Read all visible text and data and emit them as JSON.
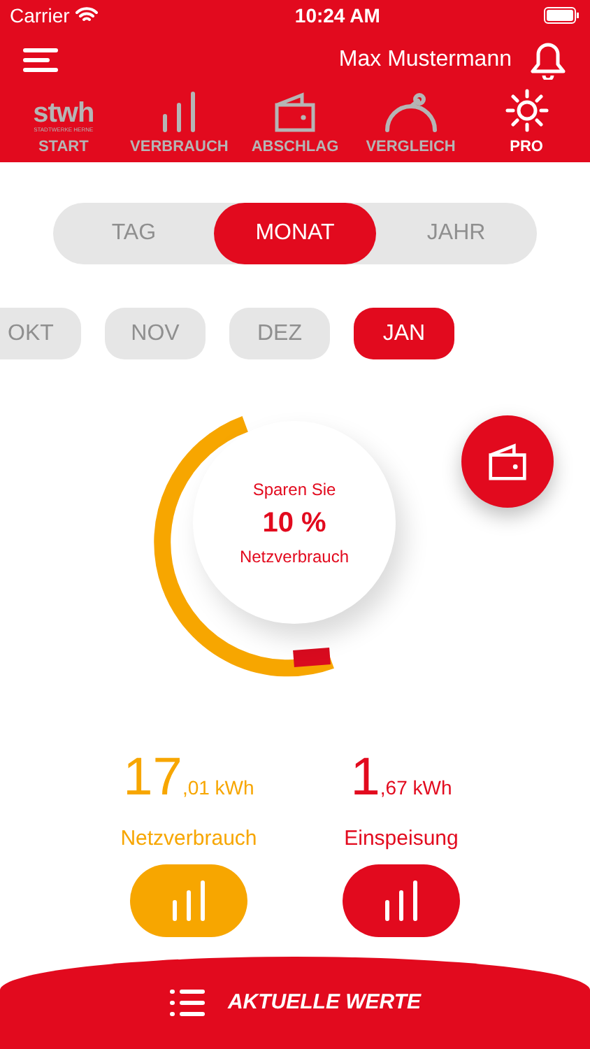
{
  "status_bar": {
    "carrier": "Carrier",
    "time": "10:24 AM"
  },
  "header": {
    "user_name": "Max Mustermann"
  },
  "logo": {
    "mark": "stwh",
    "subtitle": "STADTWERKE HERNE"
  },
  "nav": [
    {
      "kind": "logo",
      "label": "START",
      "selected": false
    },
    {
      "kind": "bars",
      "label": "VERBRAUCH",
      "selected": false
    },
    {
      "kind": "wallet",
      "label": "ABSCHLAG",
      "selected": false
    },
    {
      "kind": "gauge",
      "label": "VERGLEICH",
      "selected": false
    },
    {
      "kind": "sun",
      "label": "PRO",
      "selected": true
    }
  ],
  "periods": [
    {
      "label": "TAG",
      "selected": false
    },
    {
      "label": "MONAT",
      "selected": true
    },
    {
      "label": "JAHR",
      "selected": false
    }
  ],
  "months": [
    {
      "label": "OKT",
      "selected": false
    },
    {
      "label": "NOV",
      "selected": false
    },
    {
      "label": "DEZ",
      "selected": false
    },
    {
      "label": "JAN",
      "selected": true
    }
  ],
  "gauge": {
    "caption": "Sparen Sie",
    "value": "10 %",
    "label": "Netzverbrauch"
  },
  "stats": [
    {
      "integer": "17",
      "fraction": ",01 kWh",
      "label": "Netzverbrauch",
      "color": "#f7a600"
    },
    {
      "integer": "1",
      "fraction": ",67 kWh",
      "label": "Einspeisung",
      "color": "#e20a1e"
    }
  ],
  "footer": {
    "label": "AKTUELLE WERTE"
  }
}
